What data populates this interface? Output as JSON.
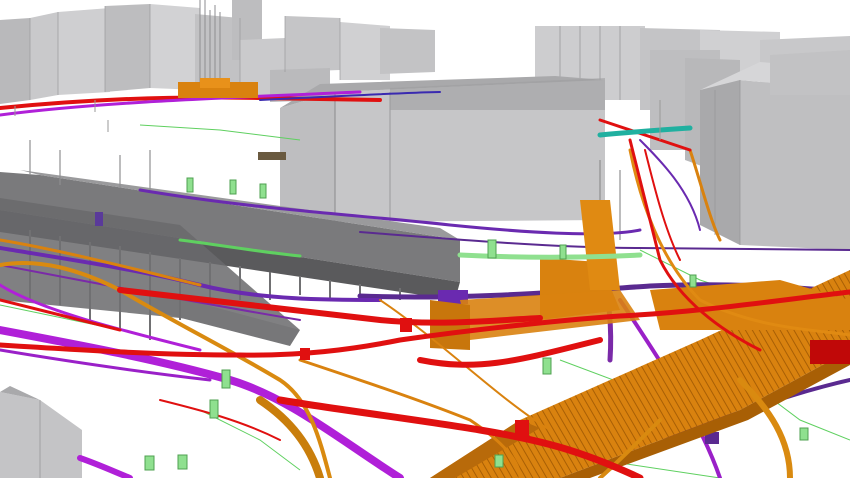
{
  "scene": {
    "description_visible_text": "",
    "background": "#ffffff",
    "colors": {
      "building_light": "#c9c9cb",
      "building_mid": "#b4b4b6",
      "building_dark": "#9a9a9c",
      "building_edge": "#8a8a8c",
      "viaduct": "#6e6e70",
      "viaduct_dark": "#555557",
      "utility_orange": "#d9820f",
      "utility_orange_dark": "#a85f05",
      "utility_red": "#e01010",
      "utility_purple": "#7a2aa8",
      "utility_magenta": "#b020d8",
      "utility_green": "#5fd060",
      "utility_teal": "#20b0a0",
      "pole_gray": "#808080"
    },
    "layers": [
      "buildings",
      "viaduct",
      "pipes",
      "ducts",
      "manholes",
      "cables"
    ]
  }
}
